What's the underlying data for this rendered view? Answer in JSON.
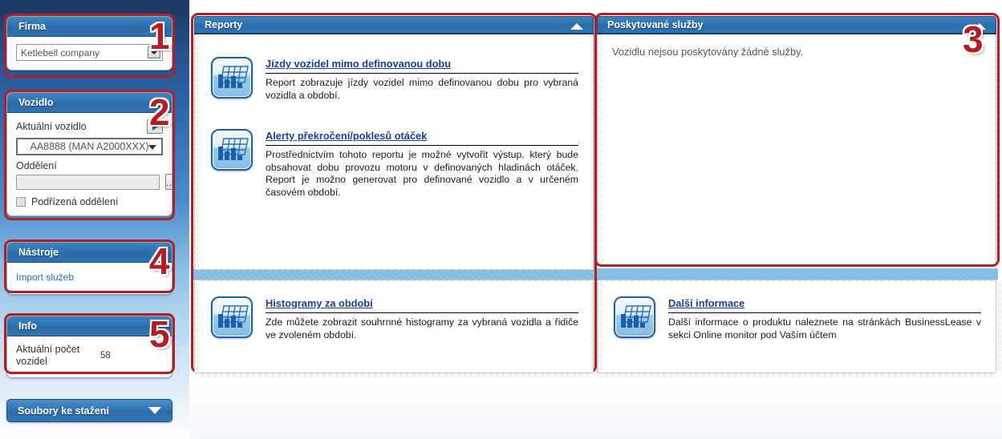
{
  "sidebar": {
    "panels": [
      {
        "id": "firma",
        "title": "Firma",
        "annotation": "1",
        "company_select": {
          "value": "Ketlebell company"
        }
      },
      {
        "id": "vozidlo",
        "title": "Vozidlo",
        "annotation": "2",
        "current_vehicle_label": "Aktuální vozidlo",
        "vehicle_select": {
          "value": "AA8888 (MAN A2000XXX)"
        },
        "department_label": "Oddělení",
        "department_input": {
          "value": ""
        },
        "dots_button_label": "...",
        "subordinate_checkbox_label": "Podřízená oddělení",
        "subordinate_checked": false
      },
      {
        "id": "nastroje",
        "title": "Nástroje",
        "annotation": "4",
        "links": [
          "Import služeb"
        ]
      },
      {
        "id": "info",
        "title": "Info",
        "annotation": "5",
        "rows": [
          {
            "label": "Aktuální počet vozidel",
            "value": "58"
          }
        ]
      }
    ],
    "downloads_button": {
      "label": "Soubory ke stažení",
      "icon": "chevron-down-icon"
    }
  },
  "main": {
    "reporty_panel": {
      "title": "Reporty",
      "collapse_icon": "chevron-up-icon",
      "items": [
        {
          "icon": "report-chart-icon",
          "title": "Jízdy vozidel mimo definovanou dobu",
          "description": "Report zobrazuje jízdy vozidel mimo definovanou dobu pro vybraná vozidla a období."
        },
        {
          "icon": "report-chart-icon",
          "title": "Alerty překročení/poklesů otáček",
          "description": "Prostřednictvím tohoto reportu je možné vytvořit výstup, který bude obsahovat dobu provozu motoru v definovaných hladinách otáček. Report je možno generovat pro definované vozidlo a v určeném časovém období."
        }
      ]
    },
    "sluzby_panel": {
      "title": "Poskytované služby",
      "annotation": "3",
      "collapse_icon": "chevron-up-icon",
      "empty_message": "Vozidlu nejsou poskytovány žádné služby."
    },
    "bottom_left_panel": {
      "items": [
        {
          "icon": "report-chart-icon",
          "title": "Histogramy za období",
          "description": "Zde můžete zobrazit souhrnné histogramy za vybraná vozidla a řidiče ve zvoleném období."
        }
      ]
    },
    "bottom_right_panel": {
      "items": [
        {
          "icon": "report-chart-icon",
          "title": "Další informace",
          "description": "Další informace o produktu naleznete na stránkách BusinessLease v sekci Online monitor pod Vaším účtem"
        }
      ]
    }
  },
  "colors": {
    "annotation_red": "#b01f24",
    "panel_header_blue": "#2f74b2",
    "link_blue": "#1e72c4",
    "report_title_blue": "#1b3f8f",
    "divider_blue": "#85bfe6",
    "sidebar_top": "#1d3a66"
  }
}
